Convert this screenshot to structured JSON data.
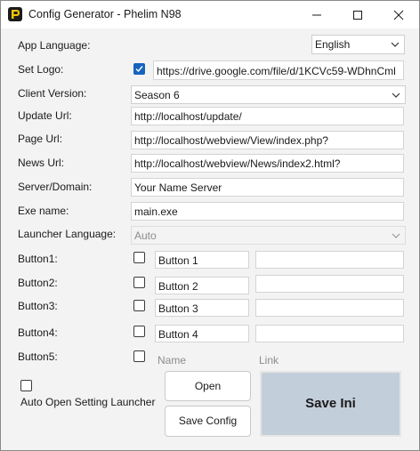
{
  "window": {
    "title": "Config Generator - Phelim N98"
  },
  "labels": {
    "app_language": "App Language:",
    "set_logo": "Set Logo:",
    "client_version": "Client Version:",
    "update_url": "Update Url:",
    "page_url": "Page Url:",
    "news_url": "News Url:",
    "server_domain": "Server/Domain:",
    "exe_name": "Exe name:",
    "launcher_language": "Launcher Language:",
    "button1": "Button1:",
    "button2": "Button2:",
    "button3": "Button3:",
    "button4": "Button4:",
    "button5": "Button5:",
    "auto_open": "Auto Open Setting Launcher"
  },
  "values": {
    "app_language": "English",
    "logo_url": "https://drive.google.com/file/d/1KCVc59-WDhnCml",
    "client_version": "Season 6",
    "update_url": "http://localhost/update/",
    "page_url": "http://localhost/webview/View/index.php?",
    "news_url": "http://localhost/webview/News/index2.html?",
    "server_domain": "Your Name Server",
    "exe_name": "main.exe",
    "launcher_language": "Auto"
  },
  "launcher_buttons": [
    {
      "name": "Button 1",
      "link": "",
      "checked": false
    },
    {
      "name": "Button 2",
      "link": "",
      "checked": false
    },
    {
      "name": "Button 3",
      "link": "",
      "checked": false
    },
    {
      "name": "Button 4",
      "link": "",
      "checked": false
    },
    {
      "name": "",
      "link": "",
      "checked": false,
      "name_placeholder": "Name",
      "link_placeholder": "Link"
    }
  ],
  "checkboxes": {
    "set_logo": true,
    "auto_open": false
  },
  "actions": {
    "open": "Open",
    "save_config": "Save Config",
    "save_ini": "Save Ini"
  },
  "colors": {
    "accent": "#1564c0",
    "save_ini_bg": "#c3cedb"
  },
  "icons": {
    "app": "app-logo-icon",
    "minimize": "minimize-icon",
    "maximize": "maximize-icon",
    "close": "close-icon",
    "dropdown": "chevron-down-icon",
    "check": "checkmark-icon"
  }
}
